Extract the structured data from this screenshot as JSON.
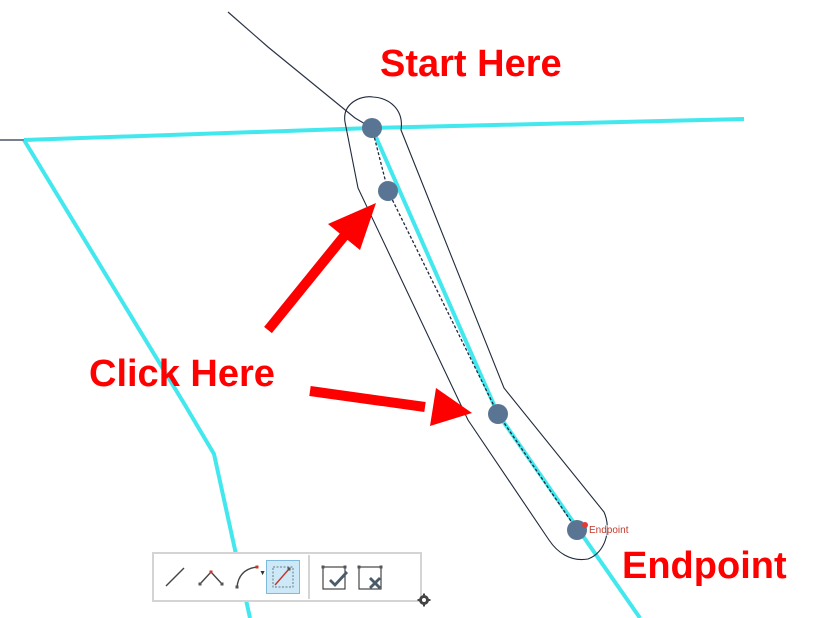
{
  "annotations": {
    "start": "Start Here",
    "click": "Click Here",
    "endpoint": "Endpoint"
  },
  "snap_tip": "Endpoint",
  "colors": {
    "annotation": "#ff0000",
    "feature_line": "#42e8ee",
    "vertex": "#5a7593",
    "buffer_outline": "#1f2a3c"
  },
  "toolbar": {
    "tools": [
      {
        "name": "line-tool",
        "icon": "straight-line-icon"
      },
      {
        "name": "polyline-tool",
        "icon": "angle-line-icon"
      },
      {
        "name": "arc-tool",
        "icon": "arc-icon",
        "has_dropdown": true
      },
      {
        "name": "trace-tool",
        "icon": "trace-icon",
        "active": true
      }
    ],
    "actions": [
      {
        "name": "finish-sketch",
        "icon": "finish-check-icon"
      },
      {
        "name": "cancel-sketch",
        "icon": "cancel-x-icon"
      }
    ]
  }
}
